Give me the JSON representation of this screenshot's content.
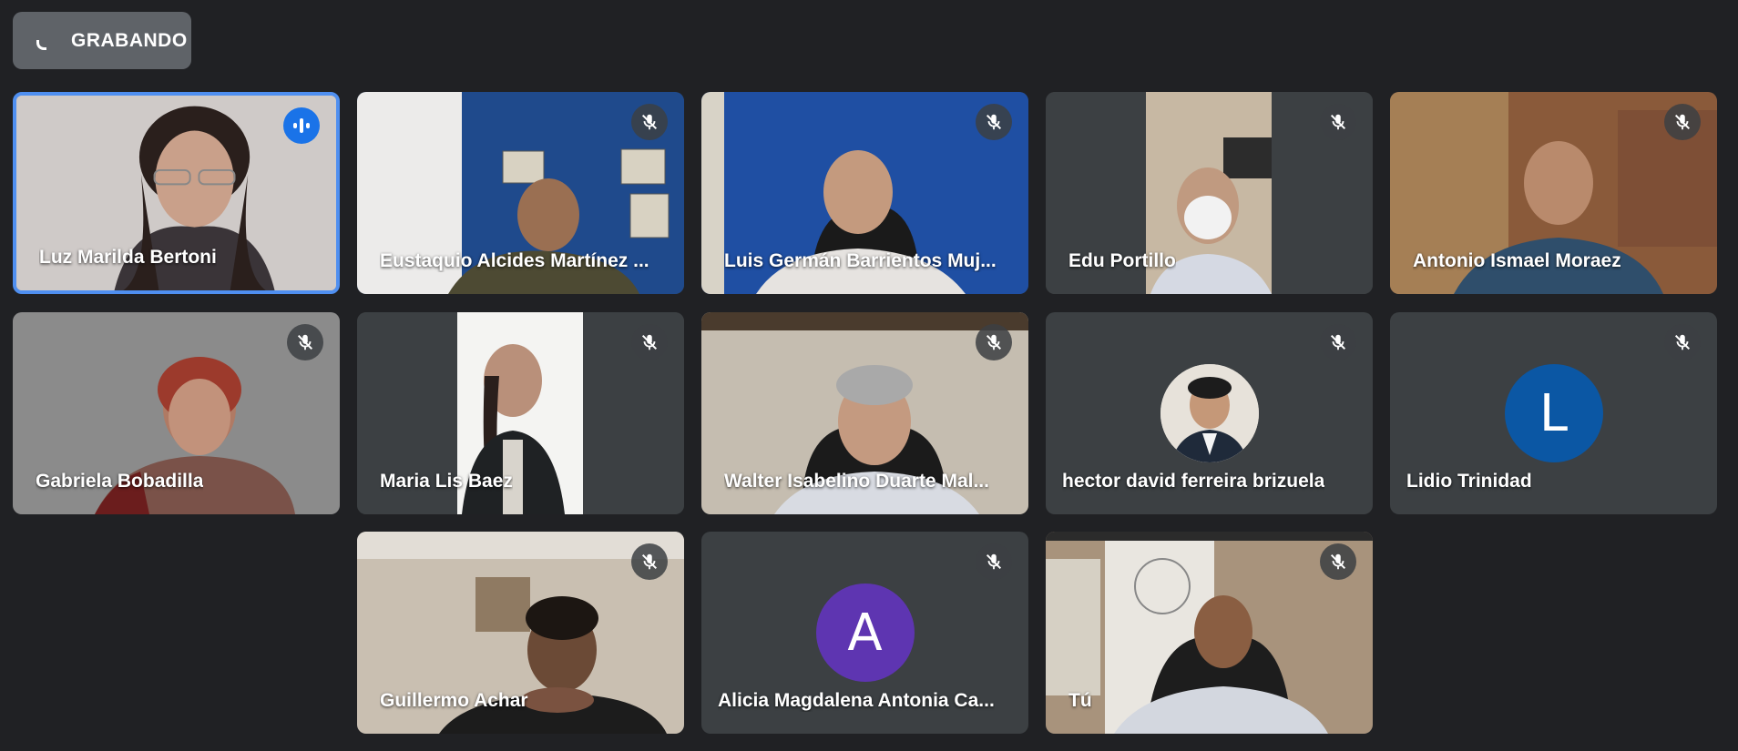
{
  "recording": {
    "label": "GRABANDO"
  },
  "participants": [
    {
      "name": "Luz Marilda Bertoni",
      "mic": "speaking-icon"
    },
    {
      "name": "Eustaquio Alcides Martínez ...",
      "mic": "mic-off-icon"
    },
    {
      "name": "Luis Germán Barrientos Muj...",
      "mic": "mic-off-icon"
    },
    {
      "name": "Edu Portillo",
      "mic": "mic-off-icon"
    },
    {
      "name": "Antonio Ismael Moraez",
      "mic": "mic-off-icon"
    },
    {
      "name": "Gabriela Bobadilla",
      "mic": "mic-off-icon"
    },
    {
      "name": "Maria Lis Baez",
      "mic": "mic-off-icon"
    },
    {
      "name": "Walter Isabelino Duarte Mal...",
      "mic": "mic-off-icon"
    },
    {
      "name": "hector david ferreira brizuela",
      "mic": "mic-off-icon"
    },
    {
      "name": "Lidio Trinidad",
      "mic": "mic-off-icon",
      "initial": "L"
    },
    {
      "name": "Guillermo Achar",
      "mic": "mic-off-icon"
    },
    {
      "name": "Alicia Magdalena Antonia Ca...",
      "mic": "mic-off-icon",
      "initial": "A"
    },
    {
      "name": "Tú",
      "mic": "mic-off-icon"
    }
  ],
  "colors": {
    "background": "#202124",
    "tile": "#3c4043",
    "active_border": "#4f8ff0",
    "avatar_l": "#0b57a4",
    "avatar_a": "#5e35b1"
  }
}
